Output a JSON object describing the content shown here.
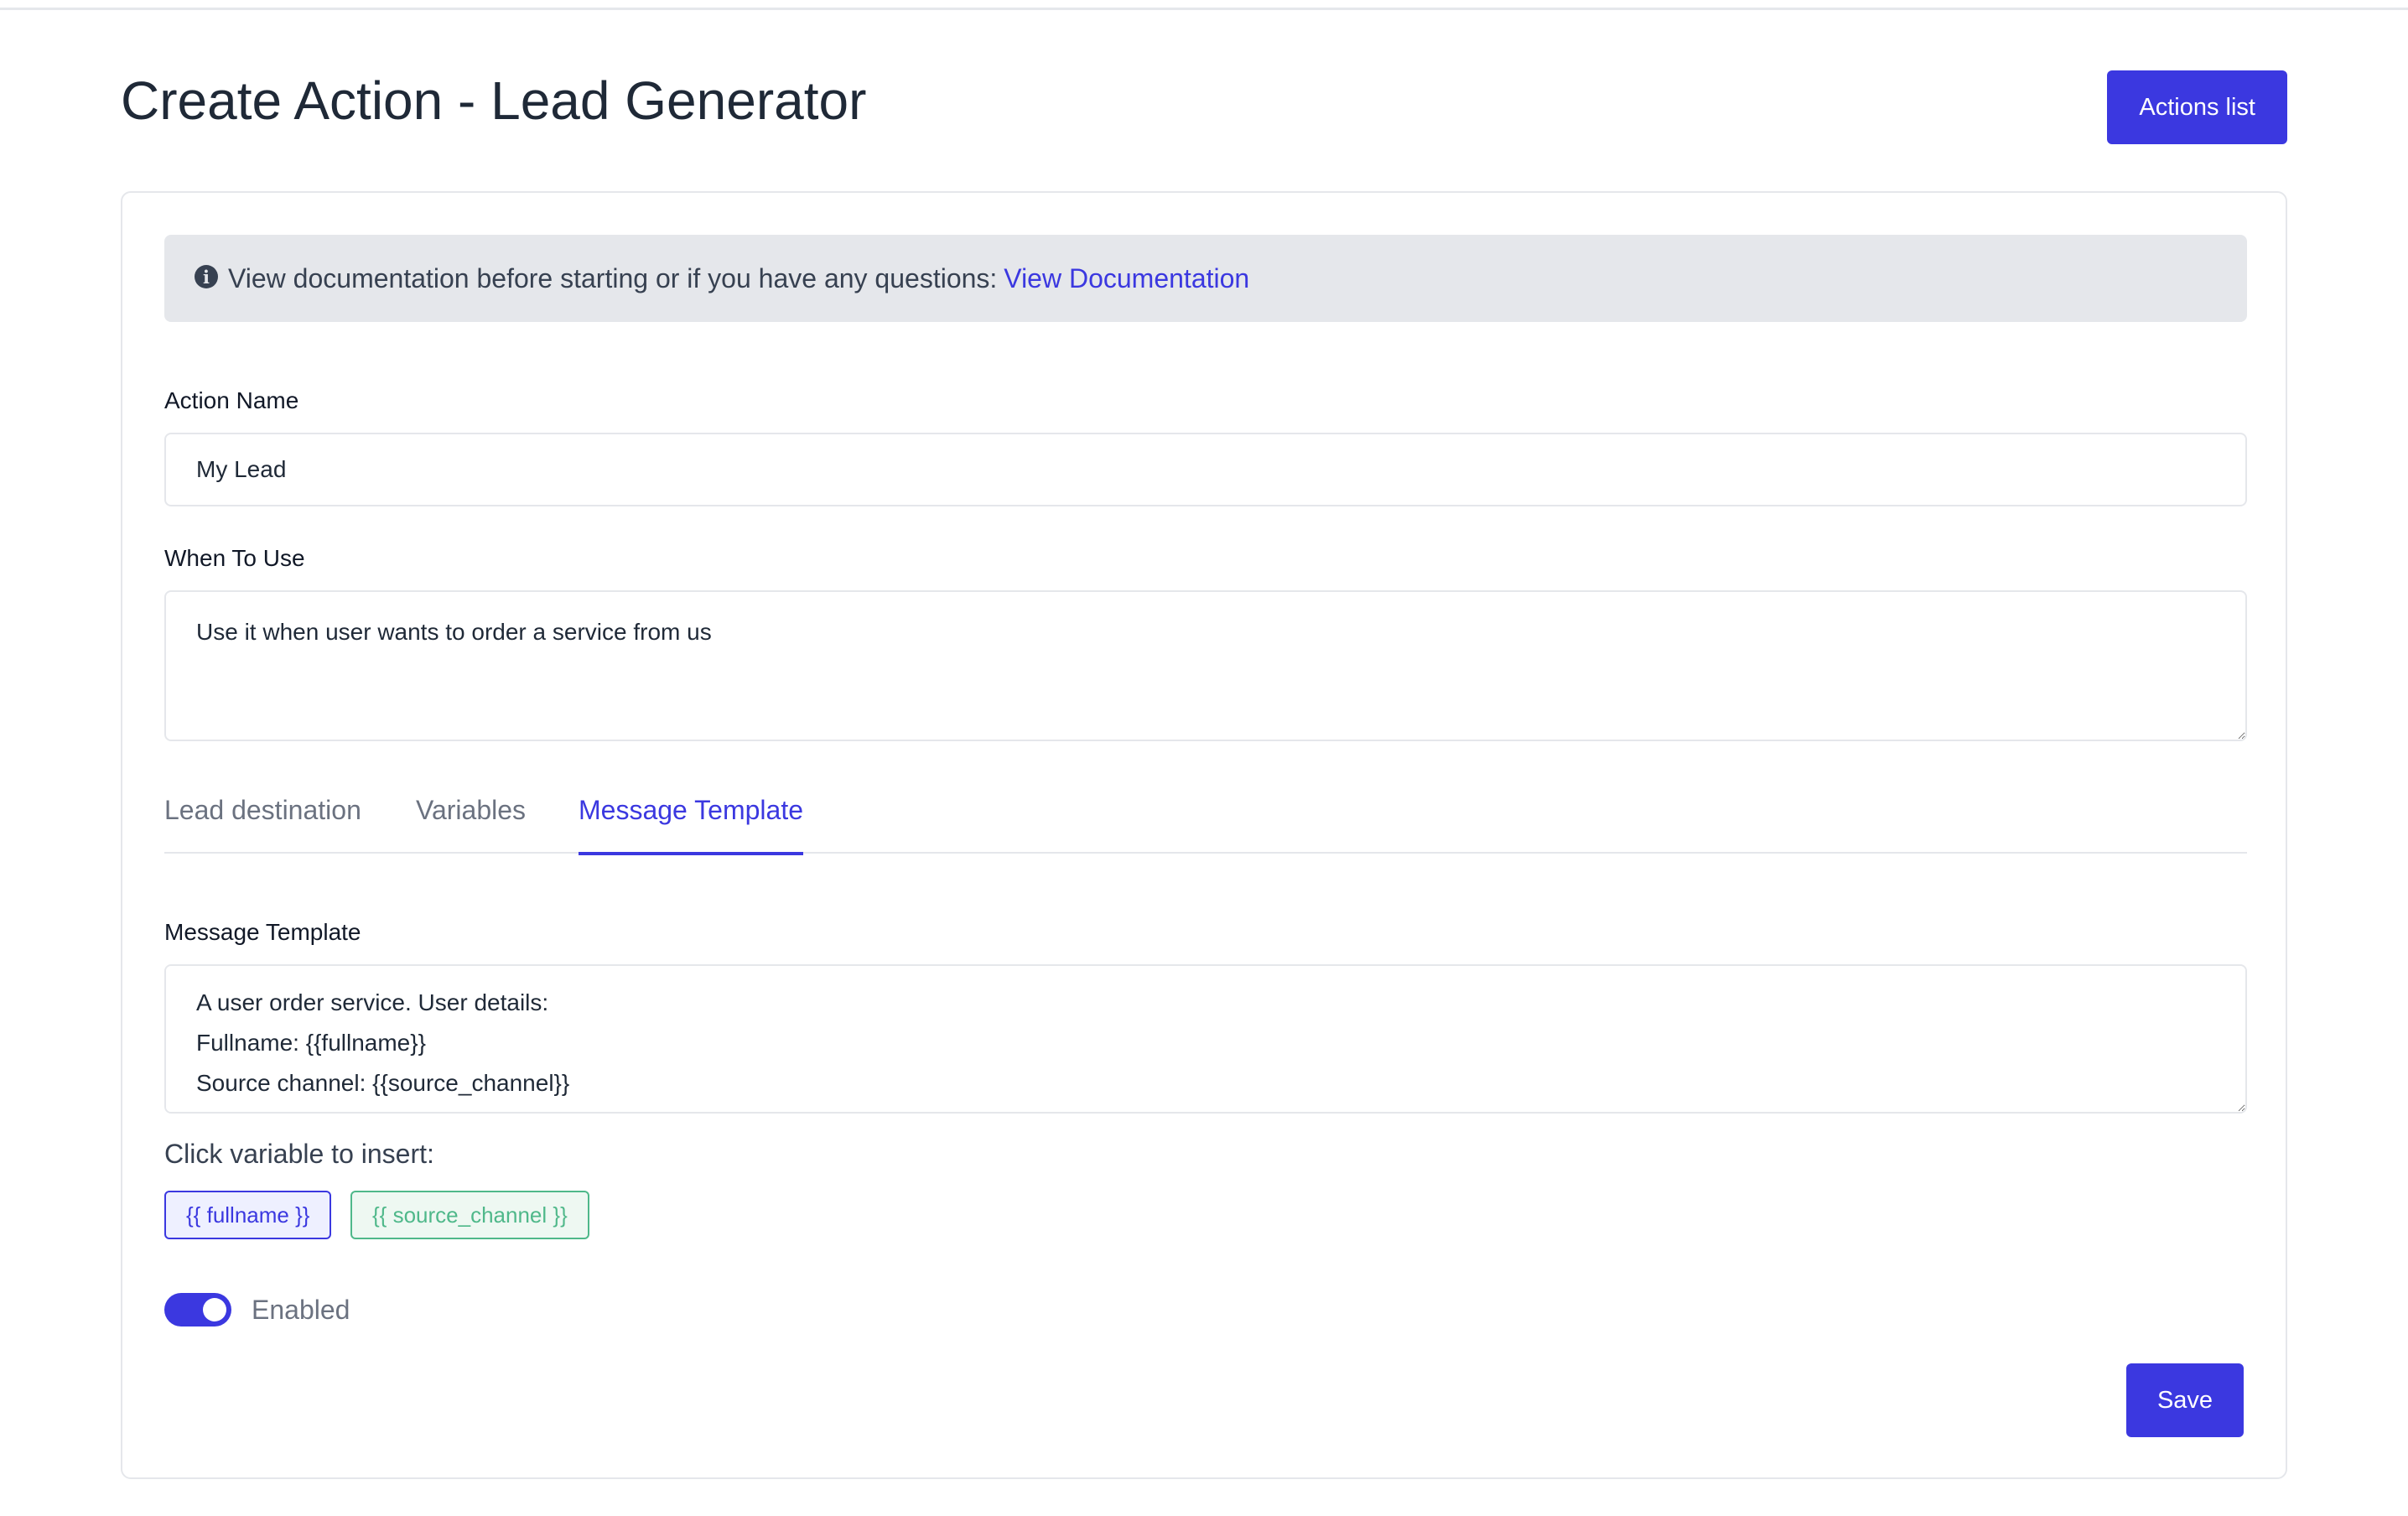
{
  "header": {
    "title": "Create Action - Lead Generator",
    "actions_list_label": "Actions list"
  },
  "info": {
    "text": "View documentation before starting or if you have any questions:",
    "link_label": "View Documentation",
    "icon": "info-circle-icon"
  },
  "form": {
    "action_name_label": "Action Name",
    "action_name_value": "My Lead",
    "when_to_use_label": "When To Use",
    "when_to_use_value": "Use it when user wants to order a service from us"
  },
  "tabs": [
    {
      "label": "Lead destination",
      "active": false
    },
    {
      "label": "Variables",
      "active": false
    },
    {
      "label": "Message Template",
      "active": true
    }
  ],
  "message_template": {
    "label": "Message Template",
    "value": "A user order service. User details:\nFullname: {{fullname}}\nSource channel: {{source_channel}}",
    "insert_hint": "Click variable to insert:",
    "variables": [
      "{{ fullname }}",
      "{{ source_channel }}"
    ]
  },
  "status": {
    "enabled": true,
    "label": "Enabled"
  },
  "footer": {
    "save_label": "Save"
  },
  "colors": {
    "accent": "#3b38e0",
    "chip_green": "#4fb88a",
    "info_bg": "#e5e7eb"
  }
}
